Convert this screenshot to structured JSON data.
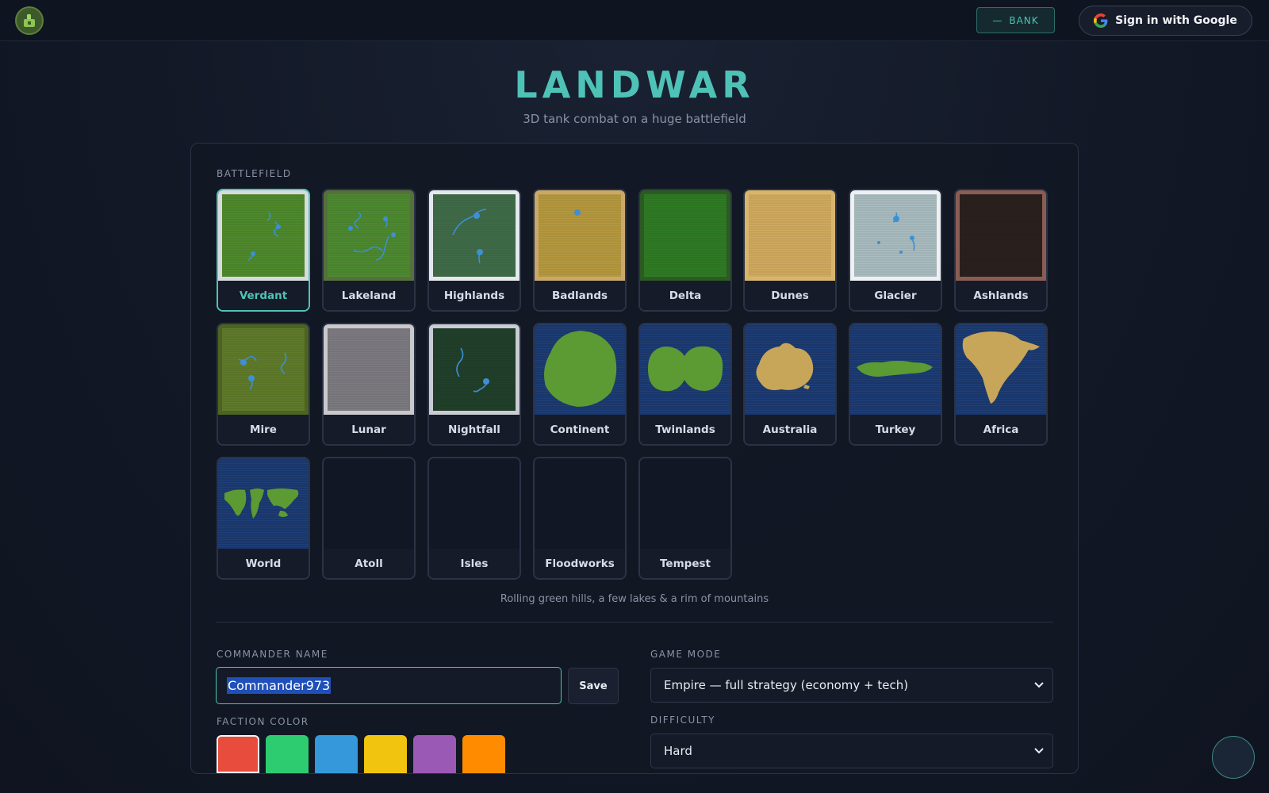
{
  "header": {
    "bank_label": "BANK",
    "bank_value": "—",
    "google_label": "Sign in with Google"
  },
  "hero": {
    "title": "LANDWAR",
    "subtitle": "3D tank combat on a huge battlefield"
  },
  "battlefield": {
    "label": "BATTLEFIELD",
    "selected": "Verdant",
    "description": "Rolling green hills, a few lakes & a rim of mountains",
    "maps": [
      {
        "name": "Verdant",
        "kind": "terrain",
        "ground": "#4f8a2c",
        "rim": "#d8dadf",
        "water": "lakes-a"
      },
      {
        "name": "Lakeland",
        "kind": "terrain",
        "ground": "#4d8a30",
        "rim": "#56703c",
        "water": "lakes-b"
      },
      {
        "name": "Highlands",
        "kind": "terrain",
        "ground": "#3f6b48",
        "rim": "#e6e8ec",
        "water": "lakes-c"
      },
      {
        "name": "Badlands",
        "kind": "terrain",
        "ground": "#b6993f",
        "rim": "#c9a86a",
        "water": "dot"
      },
      {
        "name": "Delta",
        "kind": "terrain",
        "ground": "#2f7a24",
        "rim": "#2c5a22",
        "water": "river"
      },
      {
        "name": "Dunes",
        "kind": "terrain",
        "ground": "#d0aa5e",
        "rim": "#d8b56c",
        "water": "none"
      },
      {
        "name": "Glacier",
        "kind": "terrain",
        "ground": "#a9bcc0",
        "rim": "#eef0f3",
        "water": "lakes-d"
      },
      {
        "name": "Ashlands",
        "kind": "terrain",
        "ground": "#2a211e",
        "rim": "#8a5d54",
        "water": "none"
      },
      {
        "name": "Mire",
        "kind": "terrain",
        "ground": "#5f7b2a",
        "rim": "#4c6322",
        "water": "lakes-e"
      },
      {
        "name": "Lunar",
        "kind": "terrain",
        "ground": "#7c7b80",
        "rim": "#c9c9cc",
        "water": "none"
      },
      {
        "name": "Nightfall",
        "kind": "terrain",
        "ground": "#21402a",
        "rim": "#c9ccd2",
        "water": "lakes-f"
      },
      {
        "name": "Continent",
        "kind": "island",
        "shape": "continent",
        "land": "#5c9a34"
      },
      {
        "name": "Twinlands",
        "kind": "island",
        "shape": "twin",
        "land": "#5c9a34"
      },
      {
        "name": "Australia",
        "kind": "island",
        "shape": "australia",
        "land": "#c7a65a"
      },
      {
        "name": "Turkey",
        "kind": "island",
        "shape": "turkey",
        "land": "#5c9a34"
      },
      {
        "name": "Africa",
        "kind": "island",
        "shape": "africa",
        "land": "#c7a65a"
      },
      {
        "name": "World",
        "kind": "island",
        "shape": "world",
        "land": "#5c9a34"
      },
      {
        "name": "Atoll",
        "kind": "empty"
      },
      {
        "name": "Isles",
        "kind": "empty"
      },
      {
        "name": "Floodworks",
        "kind": "empty"
      },
      {
        "name": "Tempest",
        "kind": "empty"
      }
    ]
  },
  "commander": {
    "label": "COMMANDER NAME",
    "value": "Commander973",
    "save_label": "Save"
  },
  "faction": {
    "label": "FACTION COLOR",
    "selected": 0,
    "colors": [
      "#e74c3c",
      "#2ecc71",
      "#3498db",
      "#f1c40f",
      "#9b59b6",
      "#ff8c00"
    ]
  },
  "game_mode": {
    "label": "GAME MODE",
    "value": "Empire — full strategy (economy + tech)"
  },
  "difficulty": {
    "label": "DIFFICULTY",
    "value": "Hard"
  }
}
